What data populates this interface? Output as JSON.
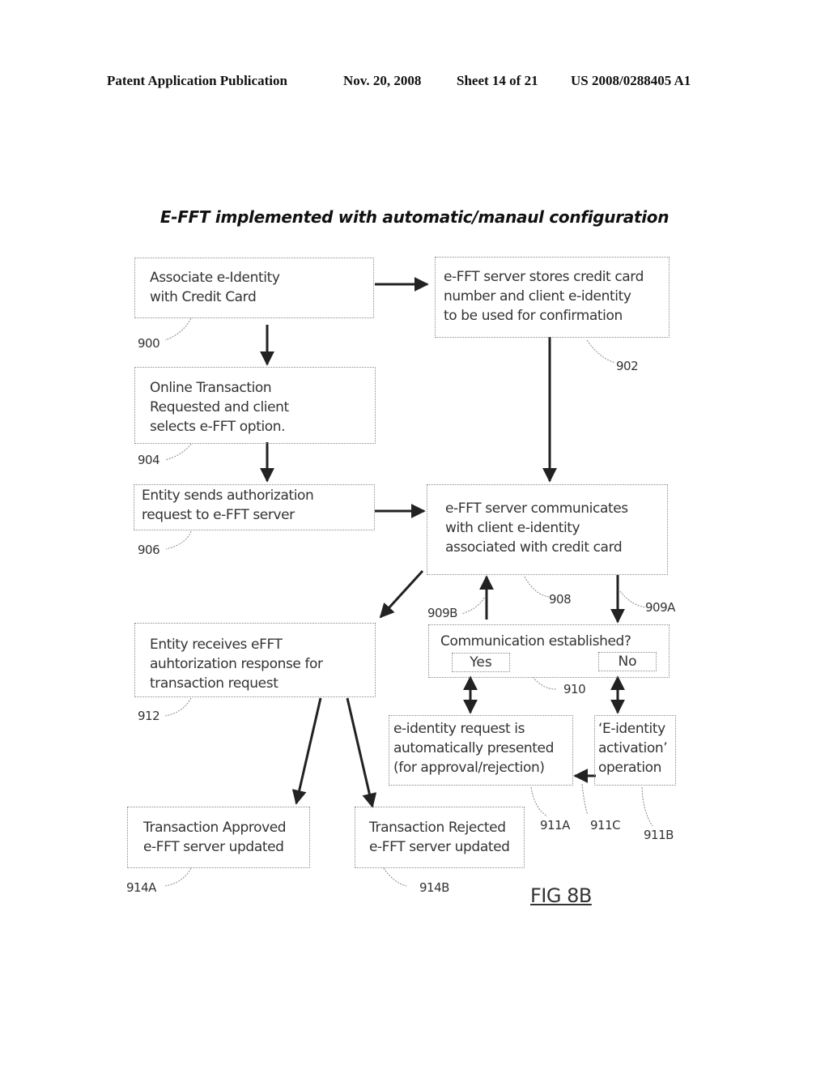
{
  "header": {
    "publication": "Patent Application Publication",
    "date": "Nov. 20, 2008",
    "sheet": "Sheet 14 of 21",
    "patent_number": "US 2008/0288405 A1"
  },
  "diagram": {
    "title": "E-FFT implemented with automatic/manaul configuration",
    "nodes": {
      "n900": {
        "text": "Associate e-Identity\nwith Credit Card",
        "ref": "900"
      },
      "n902": {
        "text": "e-FFT server stores credit card\nnumber and client e-identity\nto be used for confirmation",
        "ref": "902"
      },
      "n904": {
        "text": "Online Transaction\nRequested and client\nselects e-FFT option.",
        "ref": "904"
      },
      "n906": {
        "text": "Entity sends authorization\nrequest to e-FFT server",
        "ref": "906"
      },
      "n908": {
        "text": "e-FFT server communicates\nwith client e-identity\nassociated with credit card",
        "ref": "908"
      },
      "n910": {
        "text": "Communication established?",
        "ref": "910",
        "yes": "Yes",
        "no": "No"
      },
      "n911a": {
        "text": "e-identity request is\nautomatically presented\n(for approval/rejection)",
        "ref": "911A"
      },
      "n911b": {
        "text": "‘E-identity\nactivation’\noperation",
        "ref": "911B"
      },
      "n912": {
        "text": "Entity receives eFFT\nauhtorization response for\n transaction request",
        "ref": "912"
      },
      "n914a": {
        "text": "Transaction Approved\ne-FFT server updated",
        "ref": "914A"
      },
      "n914b": {
        "text": "Transaction Rejected\ne-FFT server updated",
        "ref": "914B"
      }
    },
    "edge_refs": {
      "e909a": "909A",
      "e909b": "909B",
      "e911c": "911C"
    },
    "edges": [
      {
        "from": "900",
        "to": "902"
      },
      {
        "from": "900",
        "to": "904"
      },
      {
        "from": "902",
        "to": "908"
      },
      {
        "from": "904",
        "to": "906"
      },
      {
        "from": "906",
        "to": "908"
      },
      {
        "from": "908",
        "to": "910",
        "ref": "909A"
      },
      {
        "from": "910",
        "to": "908",
        "ref": "909B"
      },
      {
        "from": "908",
        "to": "912"
      },
      {
        "from": "910-yes",
        "to": "911A",
        "bidirectional": true
      },
      {
        "from": "910-no",
        "to": "911B",
        "bidirectional": true
      },
      {
        "from": "911B",
        "to": "911A",
        "ref": "911C"
      },
      {
        "from": "912",
        "to": "914A"
      },
      {
        "from": "912",
        "to": "914B"
      }
    ],
    "figure_label": "FIG 8B"
  }
}
